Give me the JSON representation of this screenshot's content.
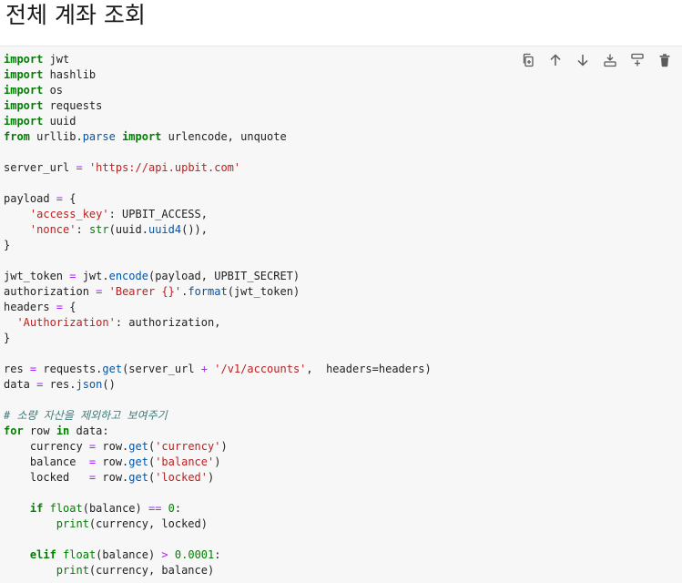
{
  "heading": "전체 계좌 조회",
  "toolbar": {
    "icons": [
      "copy-icon",
      "move-up-icon",
      "move-down-icon",
      "insert-above-icon",
      "insert-below-icon",
      "delete-icon"
    ]
  },
  "code": {
    "language": "python",
    "lines": [
      "import jwt",
      "import hashlib",
      "import os",
      "import requests",
      "import uuid",
      "from urllib.parse import urlencode, unquote",
      "",
      "server_url = 'https://api.upbit.com'",
      "",
      "payload = {",
      "    'access_key': UPBIT_ACCESS,",
      "    'nonce': str(uuid.uuid4()),",
      "}",
      "",
      "jwt_token = jwt.encode(payload, UPBIT_SECRET)",
      "authorization = 'Bearer {}'.format(jwt_token)",
      "headers = {",
      "  'Authorization': authorization,",
      "}",
      "",
      "res = requests.get(server_url + '/v1/accounts',  headers=headers)",
      "data = res.json()",
      "",
      "# 소량 자산을 제외하고 보여주기",
      "for row in data:",
      "    currency = row.get('currency')",
      "    balance  = row.get('balance')",
      "    locked   = row.get('locked')",
      "",
      "    if float(balance) == 0:",
      "        print(currency, locked)",
      "",
      "    elif float(balance) > 0.0001:",
      "        print(currency, balance)"
    ]
  }
}
